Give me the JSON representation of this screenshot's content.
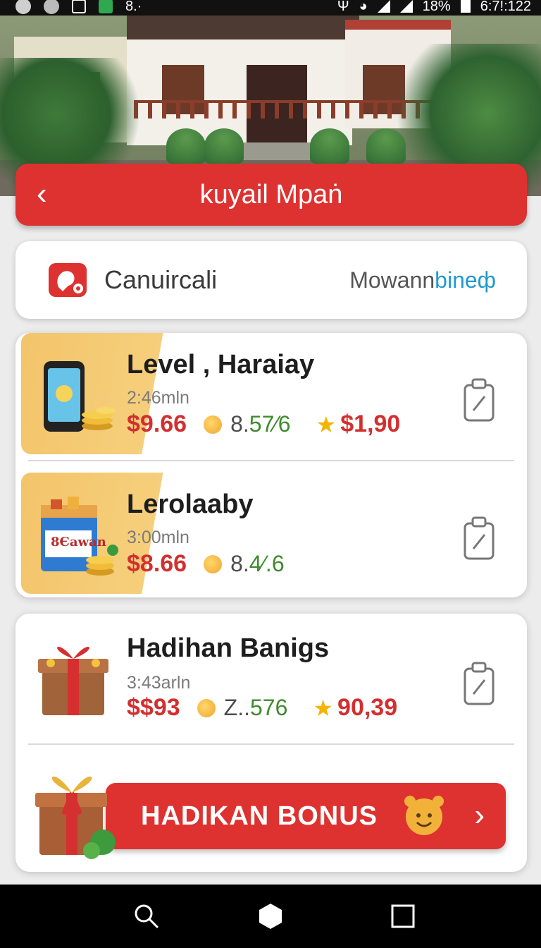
{
  "status_bar": {
    "battery": "18%",
    "time": "6:7!:122",
    "notif_text": "8.·"
  },
  "header": {
    "back_glyph": "‹",
    "title": "kuyail Mpaṅ"
  },
  "brand": {
    "name": "Canuircali",
    "partner_prefix": "Mowann",
    "partner_accent": "bineф",
    "accent_color": "#1e9bd0"
  },
  "items": [
    {
      "title": "Level , Haraiay",
      "time": "2:46mln",
      "price": "$9.66",
      "pct_prefix": "8.",
      "pct_accent": "57⁄6",
      "bonus": "$1,90"
    },
    {
      "title": "Lerolaaby",
      "time": "3:00mln",
      "price": "$8.66",
      "pct_prefix": "8.",
      "pct_accent": "4⁄.6",
      "box_label": "8Єawan"
    },
    {
      "title": "Hadihan Banigs",
      "time": "3:43arln",
      "price": "$$93",
      "pct_prefix": "Z..",
      "pct_accent": "576",
      "bonus": "90,39"
    }
  ],
  "cta": {
    "label": "HADIKAN BONUS",
    "chevron": "›"
  },
  "colors": {
    "primary_red": "#dd3230",
    "price_red": "#d32f2f",
    "green": "#3f8b2e",
    "gold": "#f4b400"
  }
}
